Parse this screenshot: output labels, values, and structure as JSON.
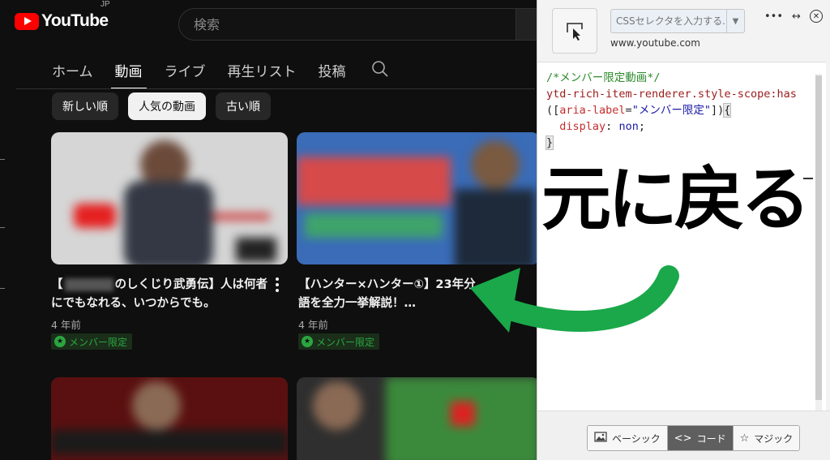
{
  "youtube": {
    "logo_text": "YouTube",
    "region": "JP",
    "search_placeholder": "検索",
    "tabs": [
      {
        "label": "ホーム"
      },
      {
        "label": "動画"
      },
      {
        "label": "ライブ"
      },
      {
        "label": "再生リスト"
      },
      {
        "label": "投稿"
      }
    ],
    "chips": [
      {
        "label": "新しい順"
      },
      {
        "label": "人気の動画"
      },
      {
        "label": "古い順"
      }
    ],
    "videos": [
      {
        "title_prefix": "【",
        "title_rest": "のしくじり武勇伝】人は何者にでもなれる、いつからでも。",
        "age": "4 年前",
        "badge": "メンバー限定"
      },
      {
        "title": "【ハンター×ハンター①】23年分\n語を全力一挙解説！…",
        "age": "4 年前",
        "badge": "メンバー限定"
      }
    ]
  },
  "overlay": {
    "text": "元に戻る",
    "arrow_color": "#1aa84a"
  },
  "extension": {
    "selector_placeholder": "CSSセレクタを入力する...",
    "domain": "www.youtube.com",
    "code": {
      "comment": "/*メンバー限定動画*/",
      "selector_start": "ytd-rich-item-renderer.style-scope:has",
      "paren_open": "([",
      "attr": "aria-label",
      "eq": "=",
      "attr_value": "\"メンバー限定\"",
      "paren_close": "])",
      "brace_open": "{",
      "prop": "display",
      "colon": ": ",
      "value": "non",
      "semicolon": ";",
      "brace_close": "}"
    },
    "modes": [
      {
        "label": "ベーシック",
        "icon": "image-icon"
      },
      {
        "label": "コード",
        "icon": "code-icon"
      },
      {
        "label": "マジック",
        "icon": "star-icon"
      }
    ]
  }
}
